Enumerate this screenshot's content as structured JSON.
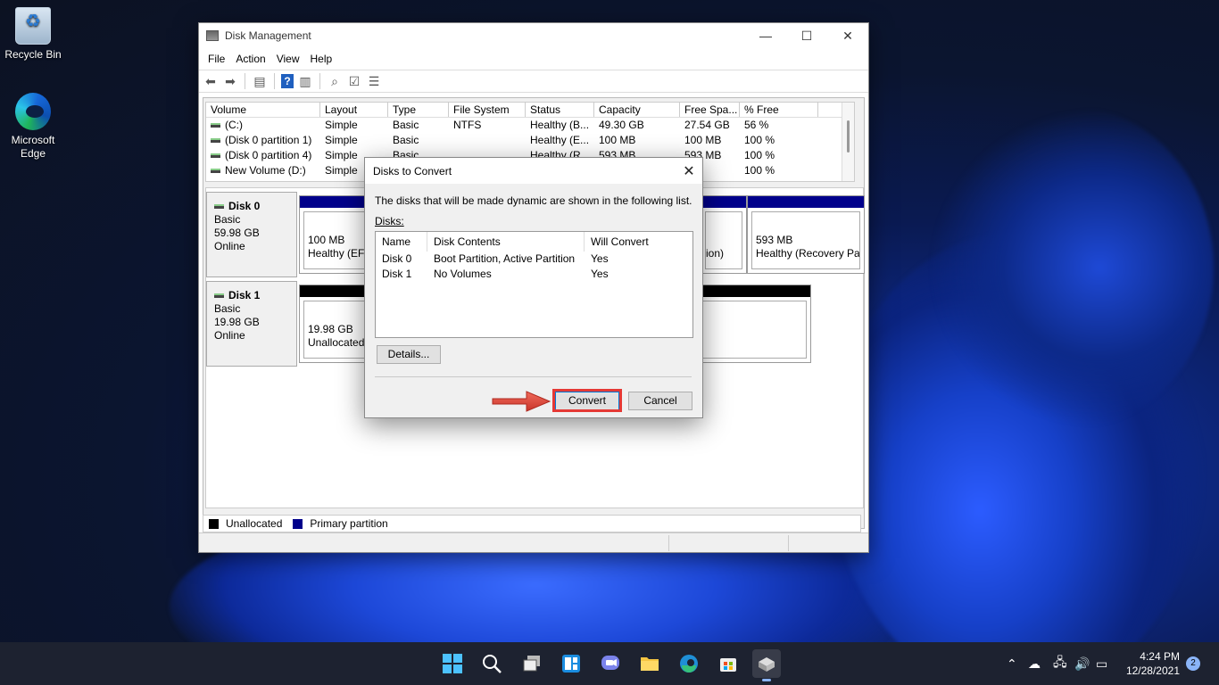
{
  "desktop": {
    "icons": [
      {
        "label": "Recycle Bin"
      },
      {
        "label": "Microsoft Edge"
      }
    ]
  },
  "window": {
    "title": "Disk Management",
    "menu": [
      "File",
      "Action",
      "View",
      "Help"
    ],
    "volume_table": {
      "columns": [
        "Volume",
        "Layout",
        "Type",
        "File System",
        "Status",
        "Capacity",
        "Free Spa...",
        "% Free"
      ],
      "rows": [
        [
          "(C:)",
          "Simple",
          "Basic",
          "NTFS",
          "Healthy (B...",
          "49.30 GB",
          "27.54 GB",
          "56 %"
        ],
        [
          "(Disk 0 partition 1)",
          "Simple",
          "Basic",
          "",
          "Healthy (E...",
          "100 MB",
          "100 MB",
          "100 %"
        ],
        [
          "(Disk 0 partition 4)",
          "Simple",
          "Basic",
          "",
          "Healthy (R...",
          "593 MB",
          "593 MB",
          "100 %"
        ],
        [
          "New Volume (D:)",
          "Simple",
          "Basic",
          "",
          "",
          "",
          "GB",
          "100 %"
        ]
      ]
    },
    "disks": [
      {
        "name": "Disk 0",
        "type": "Basic",
        "size": "59.98 GB",
        "state": "Online",
        "partitions": [
          {
            "size": "100 MB",
            "status": "Healthy (EFI S"
          },
          {
            "size": "",
            "status": "ion)"
          },
          {
            "size": "593 MB",
            "status": "Healthy (Recovery Par"
          }
        ]
      },
      {
        "name": "Disk 1",
        "type": "Basic",
        "size": "19.98 GB",
        "state": "Online",
        "partitions": [
          {
            "size": "19.98 GB",
            "status": "Unallocated"
          }
        ]
      }
    ],
    "legend": {
      "unallocated": "Unallocated",
      "primary": "Primary partition"
    }
  },
  "dialog": {
    "title": "Disks to Convert",
    "message": "The disks that will be made dynamic are shown in the following list.",
    "disks_label": "Disks:",
    "columns": [
      "Name",
      "Disk Contents",
      "Will Convert"
    ],
    "rows": [
      [
        "Disk 0",
        "Boot Partition, Active Partition",
        "Yes"
      ],
      [
        "Disk 1",
        "No Volumes",
        "Yes"
      ]
    ],
    "details_button": "Details...",
    "convert_button": "Convert",
    "cancel_button": "Cancel"
  },
  "taskbar": {
    "time": "4:24 PM",
    "date": "12/28/2021",
    "notification_count": "2"
  },
  "colors": {
    "primary_partition": "#00008b",
    "unallocated": "#000000",
    "highlight": "#e53935"
  }
}
